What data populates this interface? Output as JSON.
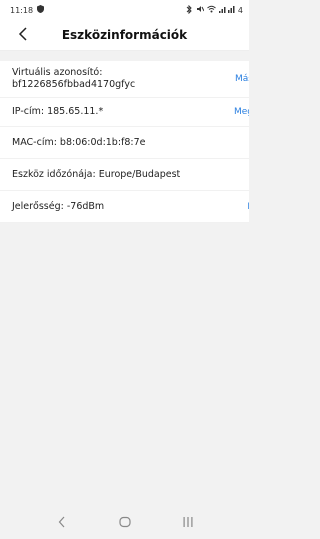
{
  "status_bar": {
    "time": "11:18",
    "battery_text": "4"
  },
  "header": {
    "title": "Eszközinformációk"
  },
  "rows": [
    {
      "line1": "Virtuális azonosító:",
      "line2": "bf1226856fbbad4170gfyc",
      "action": "Más"
    },
    {
      "text": "IP-cím: 185.65.11.*",
      "action": "Meg"
    },
    {
      "text": "MAC-cím: b8:06:0d:1b:f8:7e"
    },
    {
      "text": "Eszköz időzónája: Europe/Budapest"
    },
    {
      "text": "Jelerősség: -76dBm",
      "action": "É"
    }
  ],
  "icons": {
    "back": "chevron-left-icon",
    "nav_back": "chevron-left-icon",
    "nav_home": "home-circle-icon",
    "nav_recents": "recents-icon"
  }
}
